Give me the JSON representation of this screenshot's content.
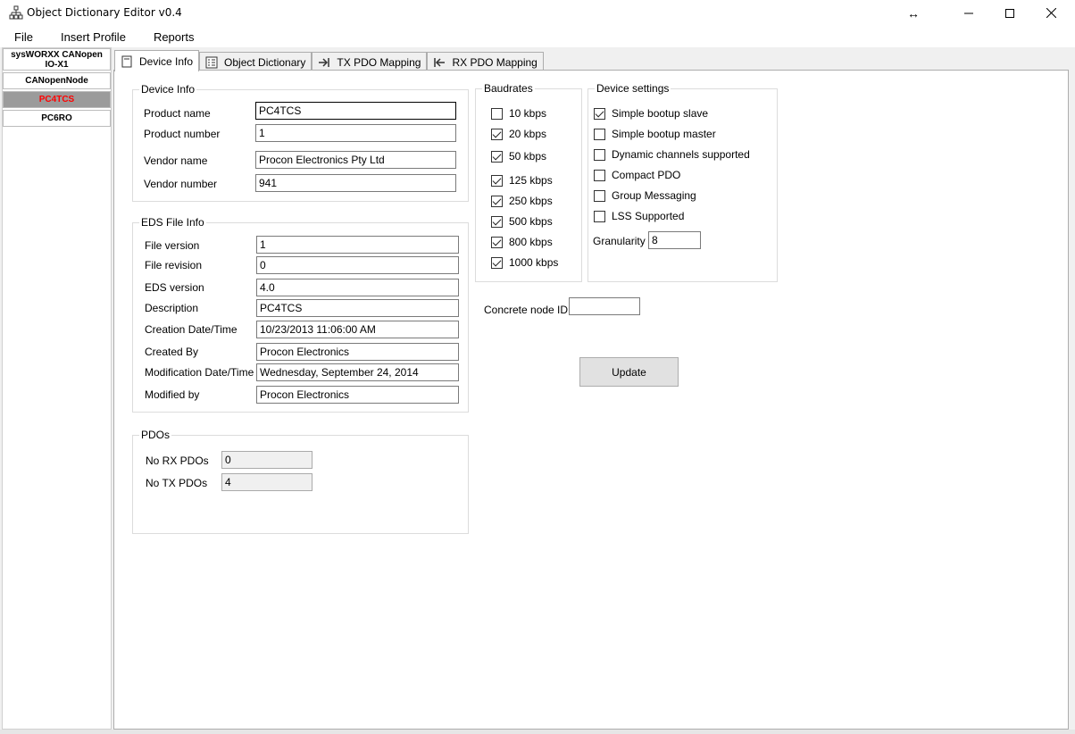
{
  "window": {
    "title": "Object Dictionary Editor v0.4",
    "resize_glyph": "↔",
    "minimize_glyph": "—",
    "maximize_glyph": "☐",
    "close_glyph": "✕"
  },
  "menu": {
    "file": "File",
    "insert_profile": "Insert Profile",
    "reports": "Reports"
  },
  "device_list": {
    "items": [
      {
        "line1": "sysWORXX CANopen",
        "line2": "IO-X1"
      },
      {
        "label": "CANopenNode"
      },
      {
        "label": "PC4TCS",
        "active": true
      },
      {
        "label": "PC6RO"
      }
    ]
  },
  "tabs": [
    {
      "label": "Device Info",
      "icon": "page-icon",
      "active": true
    },
    {
      "label": "Object Dictionary",
      "icon": "list-icon"
    },
    {
      "label": "TX PDO Mapping",
      "icon": "arrow-right-icon"
    },
    {
      "label": "RX PDO Mapping",
      "icon": "arrow-left-icon"
    }
  ],
  "device_info": {
    "title": "Device Info",
    "product_name_label": "Product name",
    "product_name": "PC4TCS",
    "product_number_label": "Product number",
    "product_number": "1",
    "vendor_name_label": "Vendor name",
    "vendor_name": "Procon Electronics Pty Ltd",
    "vendor_number_label": "Vendor number",
    "vendor_number": "941"
  },
  "eds": {
    "title": "EDS File Info",
    "file_version_label": "File version",
    "file_version": "1",
    "file_revision_label": "File revision",
    "file_revision": "0",
    "eds_version_label": "EDS version",
    "eds_version": "4.0",
    "description_label": "Description",
    "description": "PC4TCS",
    "creation_label": "Creation Date/Time",
    "creation": "10/23/2013 11:06:00 AM",
    "created_by_label": "Created By",
    "created_by": "Procon Electronics",
    "modification_label": "Modification Date/Time",
    "modification": "Wednesday, September 24, 2014",
    "modified_by_label": "Modified by",
    "modified_by": "Procon Electronics"
  },
  "pdos": {
    "title": "PDOs",
    "rx_label": "No RX PDOs",
    "rx": "0",
    "tx_label": "No TX PDOs",
    "tx": "4"
  },
  "baudrates": {
    "title": "Baudrates",
    "items": [
      {
        "label": "10 kbps",
        "checked": false
      },
      {
        "label": "20 kbps",
        "checked": true
      },
      {
        "label": "50 kbps",
        "checked": true
      },
      {
        "label": "125 kbps",
        "checked": true
      },
      {
        "label": "250 kbps",
        "checked": true
      },
      {
        "label": "500 kbps",
        "checked": true
      },
      {
        "label": "800 kbps",
        "checked": true
      },
      {
        "label": "1000 kbps",
        "checked": true
      }
    ]
  },
  "device_settings": {
    "title": "Device settings",
    "items": [
      {
        "label": "Simple bootup slave",
        "checked": true
      },
      {
        "label": "Simple bootup master",
        "checked": false
      },
      {
        "label": "Dynamic channels supported",
        "checked": false
      },
      {
        "label": "Compact PDO",
        "checked": false
      },
      {
        "label": "Group Messaging",
        "checked": false
      },
      {
        "label": "LSS Supported",
        "checked": false
      }
    ],
    "granularity_label": "Granularity",
    "granularity": "8"
  },
  "node": {
    "label": "Concrete node ID",
    "value": ""
  },
  "update_button": "Update"
}
